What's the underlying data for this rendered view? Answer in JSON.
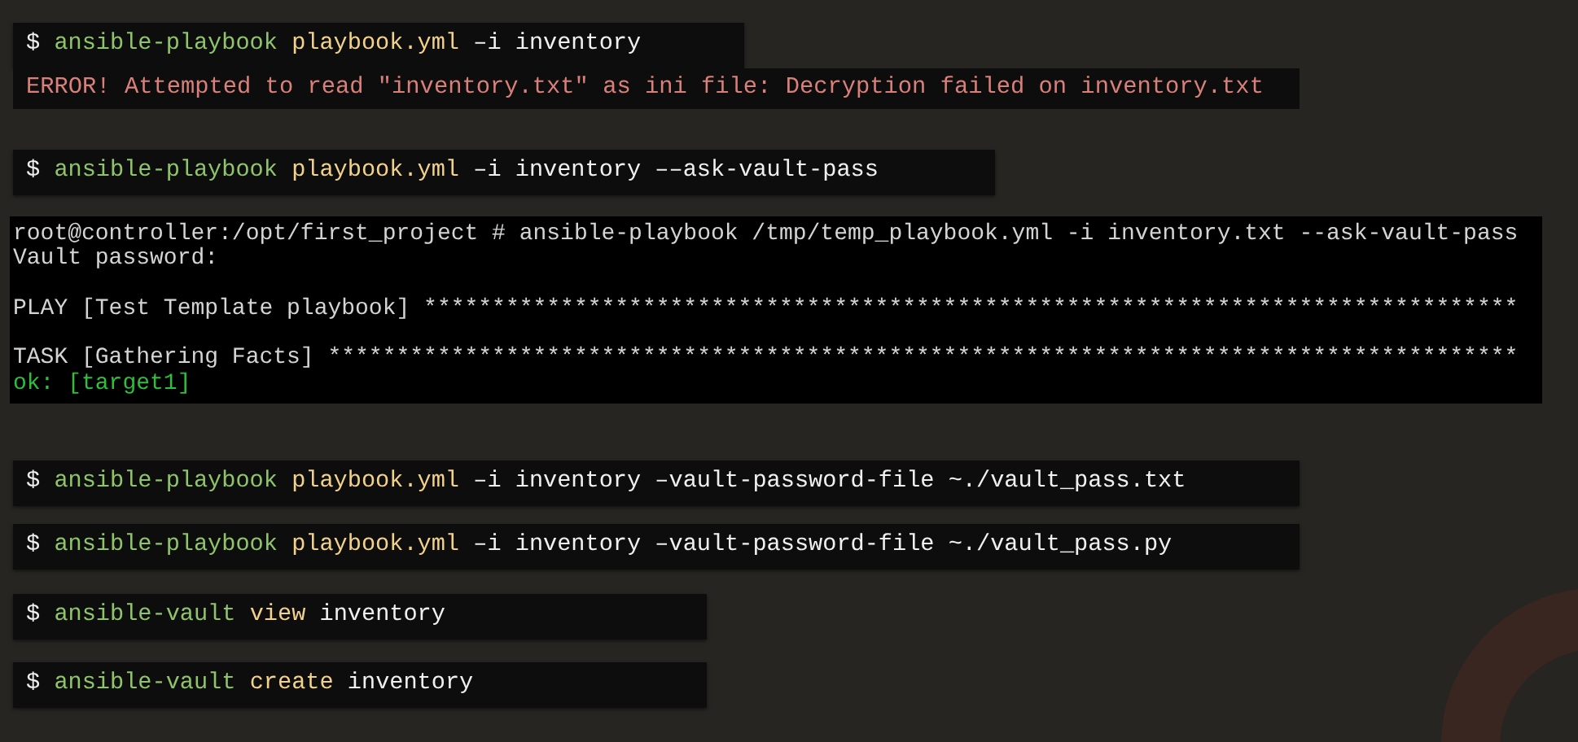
{
  "blocks": [
    {
      "kind": "command",
      "segments": [
        {
          "kind": "prompt",
          "text": "$"
        },
        {
          "kind": "program",
          "text": "ansible-playbook"
        },
        {
          "kind": "file",
          "text": "playbook.yml"
        },
        {
          "kind": "plain",
          "text": "–i inventory"
        }
      ]
    },
    {
      "kind": "error",
      "text": "ERROR! Attempted to read \"inventory.txt\" as ini file: Decryption failed on inventory.txt"
    },
    {
      "kind": "command",
      "segments": [
        {
          "kind": "prompt",
          "text": "$"
        },
        {
          "kind": "program",
          "text": "ansible-playbook"
        },
        {
          "kind": "file",
          "text": "playbook.yml"
        },
        {
          "kind": "plain",
          "text": "–i inventory ––ask-vault-pass"
        }
      ]
    },
    {
      "kind": "terminal",
      "lines": [
        {
          "kind": "normal",
          "text": "root@controller:/opt/first_project # ansible-playbook /tmp/temp_playbook.yml -i inventory.txt --ask-vault-pass"
        },
        {
          "kind": "normal",
          "text": "Vault password:"
        },
        {
          "kind": "blank"
        },
        {
          "kind": "normal",
          "text": "PLAY [Test Template playbook] ********************************************************************************"
        },
        {
          "kind": "blank"
        },
        {
          "kind": "normal",
          "text": "TASK [Gathering Facts] ***************************************************************************************"
        },
        {
          "kind": "ok",
          "text": "ok: [target1]"
        }
      ]
    },
    {
      "kind": "command",
      "segments": [
        {
          "kind": "prompt",
          "text": "$"
        },
        {
          "kind": "program",
          "text": "ansible-playbook"
        },
        {
          "kind": "file",
          "text": "playbook.yml"
        },
        {
          "kind": "plain",
          "text": "–i inventory –vault-password-file ~./vault_pass.txt"
        }
      ]
    },
    {
      "kind": "command",
      "segments": [
        {
          "kind": "prompt",
          "text": "$"
        },
        {
          "kind": "program",
          "text": "ansible-playbook"
        },
        {
          "kind": "file",
          "text": "playbook.yml"
        },
        {
          "kind": "plain",
          "text": "–i inventory –vault-password-file ~./vault_pass.py"
        }
      ]
    },
    {
      "kind": "command",
      "segments": [
        {
          "kind": "prompt",
          "text": "$"
        },
        {
          "kind": "program",
          "text": "ansible-vault"
        },
        {
          "kind": "file",
          "text": "view"
        },
        {
          "kind": "plain",
          "text": "inventory"
        }
      ]
    },
    {
      "kind": "command",
      "segments": [
        {
          "kind": "prompt",
          "text": "$"
        },
        {
          "kind": "program",
          "text": "ansible-vault"
        },
        {
          "kind": "file",
          "text": "create"
        },
        {
          "kind": "plain",
          "text": "inventory"
        }
      ]
    }
  ]
}
